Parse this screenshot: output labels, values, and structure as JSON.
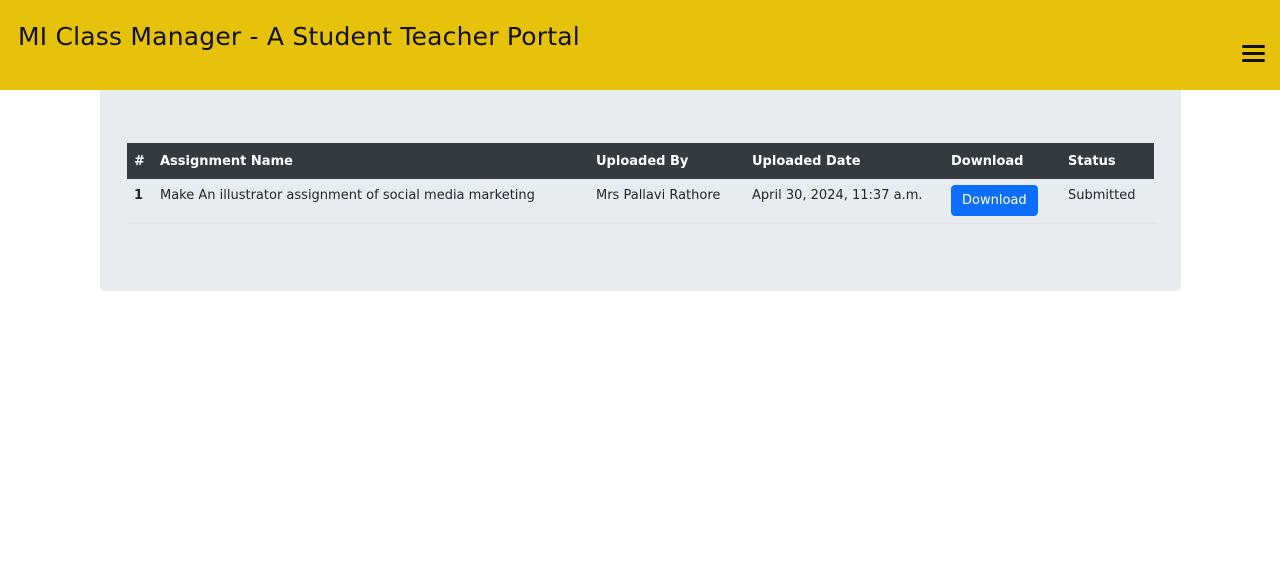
{
  "header": {
    "title": "MI Class Manager - A Student Teacher Portal",
    "menu_icon": "hamburger-menu-icon",
    "background_color": "#e6c20a"
  },
  "table": {
    "columns": [
      "#",
      "Assignment Name",
      "Uploaded By",
      "Uploaded Date",
      "Download",
      "Status"
    ],
    "rows": [
      {
        "num": "1",
        "assignment_name": "Make An illustrator assignment of social media marketing",
        "uploaded_by": "Mrs Pallavi Rathore",
        "uploaded_date": "April 30, 2024, 11:37 a.m.",
        "download_label": "Download",
        "status": "Submitted"
      }
    ]
  },
  "colors": {
    "table_header": "#343a40",
    "button_primary": "#0d6efd",
    "card_background": "#e9ecef"
  }
}
